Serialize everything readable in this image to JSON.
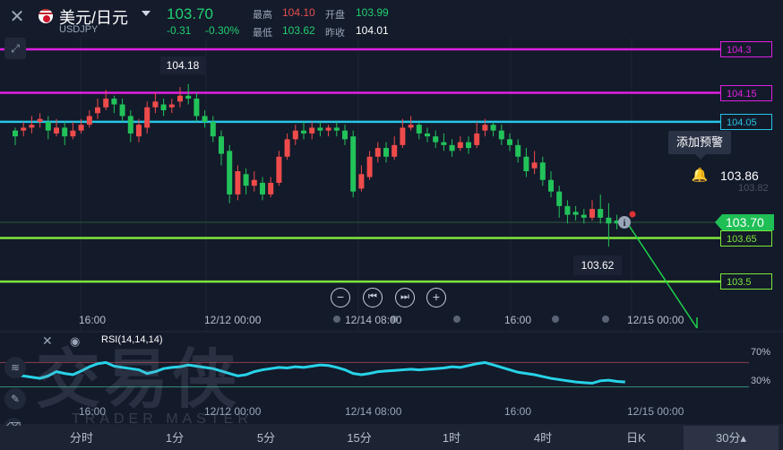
{
  "header": {
    "title": "美元/日元",
    "code": "USDJPY",
    "price": "103.70",
    "change": "-0.31",
    "change_pct": "-0.30%",
    "quotes": [
      {
        "label": "最高",
        "value": "104.10",
        "color": "#e84e4e"
      },
      {
        "label": "开盘",
        "value": "103.99",
        "color": "#20d070"
      },
      {
        "label": "最低",
        "value": "103.62",
        "color": "#20d070"
      },
      {
        "label": "昨收",
        "value": "104.01",
        "color": "#ffffff"
      }
    ]
  },
  "chart_data": {
    "type": "candlestick",
    "ylim": [
      103.42,
      104.34
    ],
    "x_ticks": [
      "16:00",
      "12/12 00:00",
      "12/14 08:00",
      "16:00",
      "12/15 00:00"
    ],
    "callouts": {
      "high": "104.18",
      "low": "103.62"
    },
    "horizontal_lines": [
      {
        "value": 104.3,
        "label": "104.3",
        "color": "#e020e0"
      },
      {
        "value": 104.15,
        "label": "104.15",
        "color": "#e020e0"
      },
      {
        "value": 104.05,
        "label": "104.05",
        "color": "#27c6e6"
      },
      {
        "value": 103.65,
        "label": "103.65",
        "color": "#7ee83a"
      },
      {
        "value": 103.5,
        "label": "103.5",
        "color": "#7ee83a"
      }
    ],
    "current_price": "103.70",
    "alert": {
      "tooltip": "添加预警",
      "price": "103.86",
      "sub_price": "103.82"
    },
    "candles": [
      [
        104.02,
        104.0,
        104.03,
        103.97
      ],
      [
        104.02,
        104.03,
        104.05,
        104.0
      ],
      [
        104.03,
        104.04,
        104.07,
        104.01
      ],
      [
        104.05,
        104.06,
        104.08,
        104.03
      ],
      [
        104.05,
        104.02,
        104.07,
        103.99
      ],
      [
        104.01,
        104.03,
        104.06,
        104.0
      ],
      [
        104.03,
        104.0,
        104.05,
        103.97
      ],
      [
        104.0,
        104.02,
        104.05,
        103.99
      ],
      [
        104.02,
        104.04,
        104.06,
        104.01
      ],
      [
        104.04,
        104.07,
        104.09,
        104.03
      ],
      [
        104.08,
        104.1,
        104.13,
        104.06
      ],
      [
        104.1,
        104.13,
        104.16,
        104.09
      ],
      [
        104.13,
        104.11,
        104.14,
        104.08
      ],
      [
        104.11,
        104.07,
        104.13,
        104.05
      ],
      [
        104.07,
        104.01,
        104.09,
        103.98
      ],
      [
        104.0,
        104.04,
        104.06,
        103.98
      ],
      [
        104.03,
        104.1,
        104.12,
        104.01
      ],
      [
        104.1,
        104.12,
        104.15,
        104.08
      ],
      [
        104.11,
        104.09,
        104.13,
        104.07
      ],
      [
        104.1,
        104.11,
        104.13,
        104.08
      ],
      [
        104.12,
        104.14,
        104.17,
        104.1
      ],
      [
        104.14,
        104.13,
        104.18,
        104.11
      ],
      [
        104.13,
        104.07,
        104.15,
        104.05
      ],
      [
        104.07,
        104.05,
        104.09,
        104.03
      ],
      [
        104.05,
        104.0,
        104.07,
        103.98
      ],
      [
        104.0,
        103.94,
        104.02,
        103.9
      ],
      [
        103.95,
        103.8,
        103.97,
        103.77
      ],
      [
        103.8,
        103.88,
        103.9,
        103.78
      ],
      [
        103.87,
        103.83,
        103.89,
        103.8
      ],
      [
        103.83,
        103.85,
        103.88,
        103.81
      ],
      [
        103.84,
        103.8,
        103.86,
        103.78
      ],
      [
        103.8,
        103.84,
        103.86,
        103.79
      ],
      [
        103.84,
        103.93,
        103.95,
        103.83
      ],
      [
        103.93,
        103.99,
        104.01,
        103.92
      ],
      [
        103.99,
        104.02,
        104.04,
        103.97
      ],
      [
        104.02,
        104.01,
        104.05,
        103.99
      ],
      [
        104.01,
        104.03,
        104.05,
        103.99
      ],
      [
        104.03,
        104.02,
        104.05,
        104.0
      ],
      [
        104.02,
        104.03,
        104.04,
        104.0
      ],
      [
        104.03,
        104.02,
        104.05,
        104.0
      ],
      [
        104.02,
        103.99,
        104.04,
        103.97
      ],
      [
        104.0,
        103.81,
        104.02,
        103.79
      ],
      [
        103.82,
        103.87,
        103.9,
        103.81
      ],
      [
        103.86,
        103.93,
        103.95,
        103.85
      ],
      [
        103.93,
        103.96,
        103.98,
        103.91
      ],
      [
        103.96,
        103.93,
        103.98,
        103.91
      ],
      [
        103.93,
        103.97,
        104.0,
        103.92
      ],
      [
        103.97,
        104.03,
        104.06,
        103.96
      ],
      [
        104.03,
        104.04,
        104.07,
        104.02
      ],
      [
        104.04,
        104.01,
        104.05,
        103.99
      ],
      [
        104.01,
        104.0,
        104.03,
        103.98
      ],
      [
        104.0,
        103.98,
        104.02,
        103.96
      ],
      [
        103.98,
        103.97,
        104.01,
        103.95
      ],
      [
        103.97,
        103.95,
        103.99,
        103.93
      ],
      [
        103.96,
        103.98,
        104.0,
        103.95
      ],
      [
        103.98,
        103.96,
        104.0,
        103.94
      ],
      [
        103.97,
        104.01,
        104.05,
        103.96
      ],
      [
        104.02,
        104.04,
        104.06,
        104.0
      ],
      [
        104.04,
        104.02,
        104.05,
        104.0
      ],
      [
        104.02,
        103.99,
        104.04,
        103.97
      ],
      [
        103.99,
        103.97,
        104.01,
        103.95
      ],
      [
        103.97,
        103.93,
        103.99,
        103.91
      ],
      [
        103.93,
        103.88,
        103.96,
        103.86
      ],
      [
        103.89,
        103.91,
        103.95,
        103.87
      ],
      [
        103.91,
        103.85,
        103.93,
        103.83
      ],
      [
        103.85,
        103.81,
        103.88,
        103.79
      ],
      [
        103.81,
        103.76,
        103.83,
        103.72
      ],
      [
        103.76,
        103.73,
        103.78,
        103.7
      ],
      [
        103.74,
        103.73,
        103.76,
        103.71
      ],
      [
        103.73,
        103.72,
        103.75,
        103.7
      ],
      [
        103.72,
        103.75,
        103.78,
        103.71
      ],
      [
        103.75,
        103.72,
        103.8,
        103.7
      ],
      [
        103.72,
        103.7,
        103.77,
        103.62
      ],
      [
        103.71,
        103.7,
        103.73,
        103.68
      ]
    ]
  },
  "rsi": {
    "label": "RSI(14,14,14)",
    "levels": [
      "70%",
      "30%"
    ],
    "values": [
      50,
      48,
      46,
      44,
      48,
      55,
      52,
      50,
      56,
      63,
      68,
      70,
      64,
      62,
      60,
      58,
      52,
      55,
      60,
      62,
      63,
      66,
      64,
      62,
      60,
      56,
      52,
      48,
      50,
      55,
      58,
      60,
      62,
      61,
      63,
      62,
      64,
      66,
      65,
      62,
      58,
      52,
      50,
      52,
      55,
      56,
      57,
      58,
      59,
      58,
      59,
      60,
      61,
      63,
      62,
      65,
      68,
      70,
      66,
      62,
      58,
      54,
      52,
      50,
      47,
      44,
      42,
      40,
      38,
      37,
      36,
      40,
      41,
      39,
      38
    ]
  },
  "controls": [
    "−",
    "⏮",
    "⏭",
    "+"
  ],
  "watermark": {
    "cn": "交易侠",
    "en": "TRADER MASTER"
  },
  "periods": [
    {
      "label": "分时"
    },
    {
      "label": "1分"
    },
    {
      "label": "5分"
    },
    {
      "label": "15分"
    },
    {
      "label": "1时"
    },
    {
      "label": "4时"
    },
    {
      "label": "日K"
    },
    {
      "label": "30分▴"
    }
  ],
  "colors": {
    "up": "#ef4b4b",
    "down": "#22c35a",
    "rsi": "#27d3e8"
  }
}
